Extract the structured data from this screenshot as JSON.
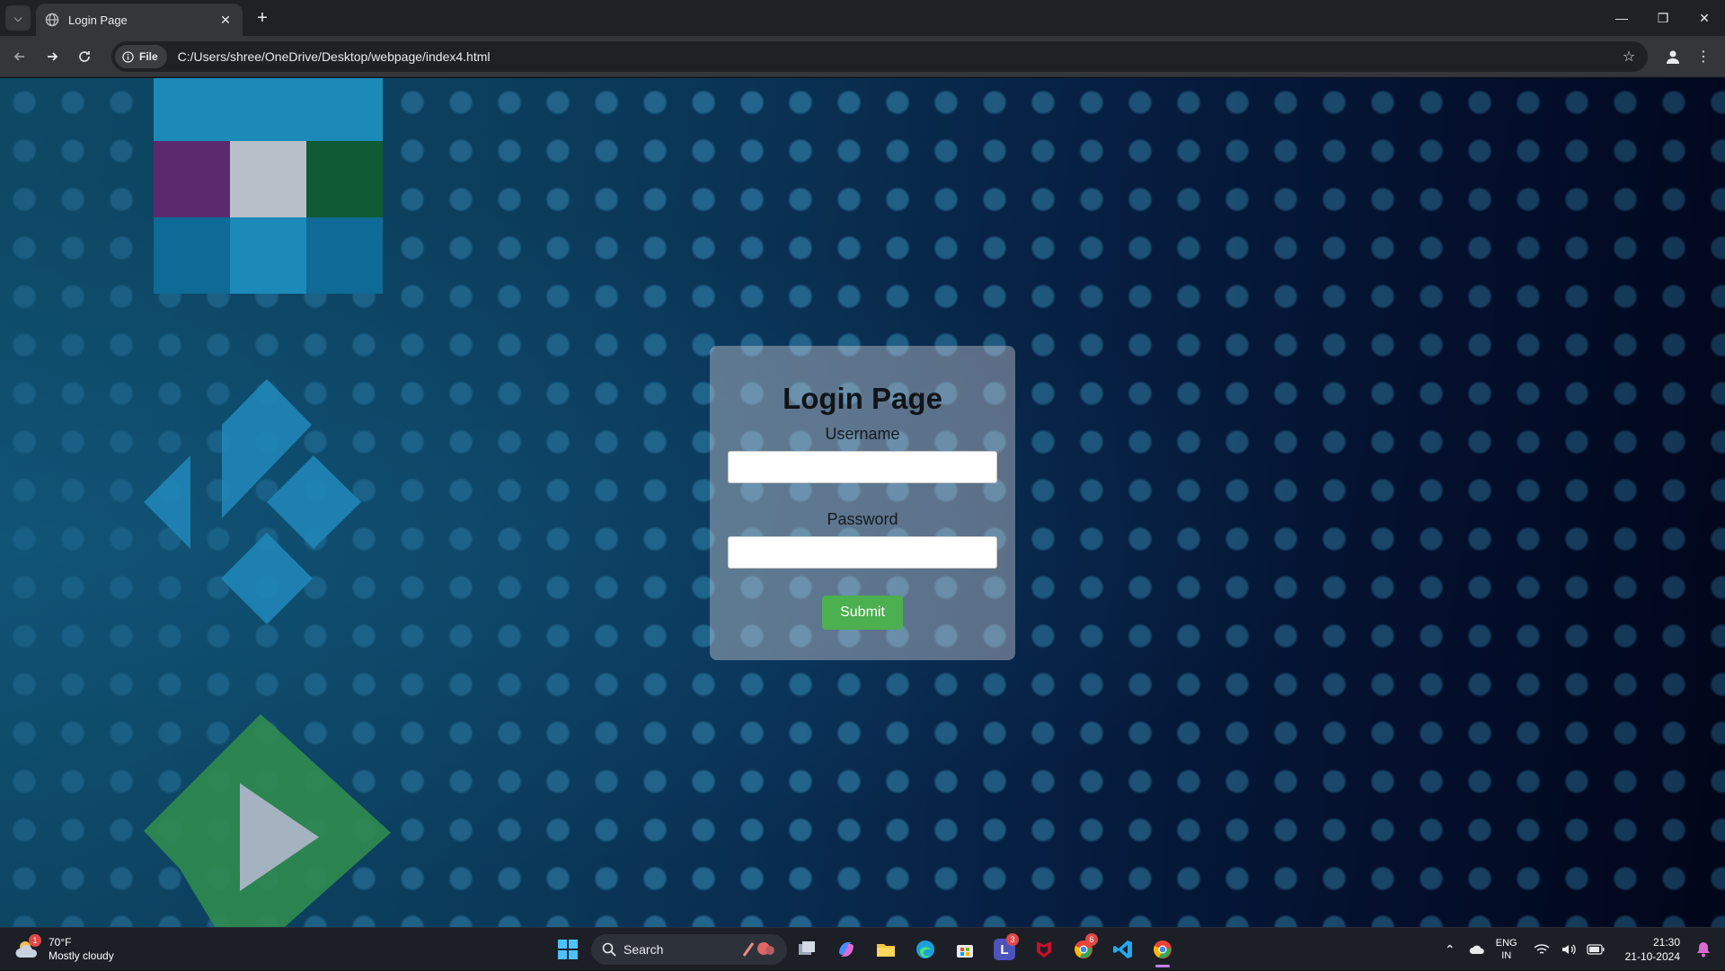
{
  "browser": {
    "tab_title": "Login Page",
    "file_chip": "File",
    "url": "C:/Users/shree/OneDrive/Desktop/webpage/index4.html"
  },
  "page": {
    "login_title": "Login Page",
    "username_label": "Username",
    "username_value": "",
    "password_label": "Password",
    "password_value": "",
    "submit_label": "Submit"
  },
  "taskbar": {
    "weather_temp": "70°F",
    "weather_desc": "Mostly cloudy",
    "weather_badge": "1",
    "search_label": "Search",
    "apps": [
      {
        "name": "task-view-icon"
      },
      {
        "name": "copilot-icon"
      },
      {
        "name": "file-explorer-icon"
      },
      {
        "name": "edge-icon"
      },
      {
        "name": "store-icon"
      },
      {
        "name": "teams-l-icon",
        "badge": "3"
      },
      {
        "name": "mcafee-icon"
      },
      {
        "name": "chrome-alt-icon",
        "badge": "6"
      },
      {
        "name": "vscode-icon"
      },
      {
        "name": "chrome-icon"
      }
    ],
    "lang_top": "ENG",
    "lang_bottom": "IN",
    "time": "21:30",
    "date": "21-10-2024"
  },
  "colors": {
    "submit": "#4caf50",
    "tile_purple": "#5b2a6e",
    "tile_grey": "#b7c0c8",
    "tile_green": "#0f5a34",
    "tile_blue": "#1b8ab8",
    "kodi_blue": "#1f86b8",
    "play_green": "#2f8a4f"
  }
}
